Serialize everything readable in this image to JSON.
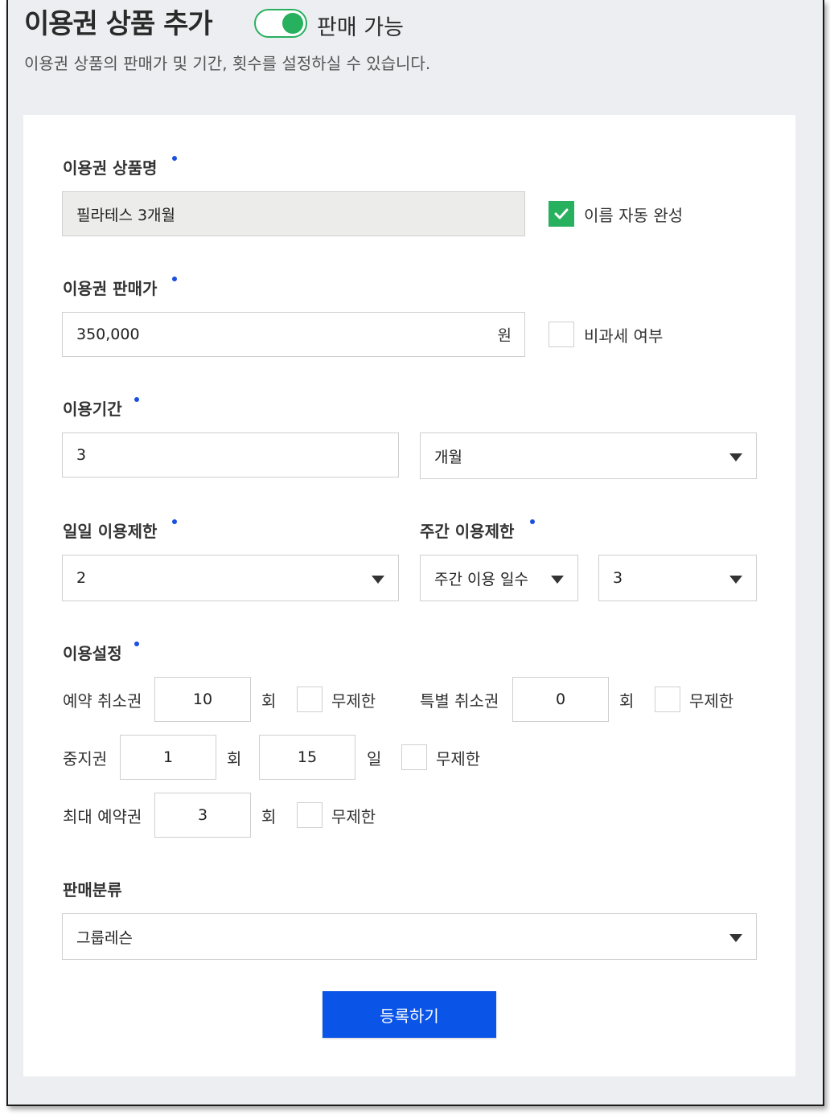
{
  "header": {
    "title": "이용권 상품 추가",
    "toggle_label": "판매 가능",
    "subtitle": "이용권 상품의 판매가 및 기간, 횟수를 설정하실 수 있습니다."
  },
  "form": {
    "product_name": {
      "label": "이용권 상품명",
      "value": "필라테스 3개월",
      "auto_complete_label": "이름 자동 완성"
    },
    "price": {
      "label": "이용권 판매가",
      "value": "350,000",
      "unit": "원",
      "tax_free_label": "비과세 여부"
    },
    "period": {
      "label": "이용기간",
      "value": "3",
      "unit_select": "개월"
    },
    "daily_limit": {
      "label": "일일 이용제한",
      "value": "2"
    },
    "weekly_limit": {
      "label": "주간 이용제한",
      "type_select": "주간 이용 일수",
      "value": "3"
    },
    "usage": {
      "label": "이용설정",
      "reservation_cancel": {
        "label": "예약 취소권",
        "value": "10",
        "unit": "회",
        "unlimited_label": "무제한"
      },
      "special_cancel": {
        "label": "특별 취소권",
        "value": "0",
        "unit": "회",
        "unlimited_label": "무제한"
      },
      "pause": {
        "label": "중지권",
        "count": "1",
        "count_unit": "회",
        "days": "15",
        "days_unit": "일",
        "unlimited_label": "무제한"
      },
      "max_reservation": {
        "label": "최대 예약권",
        "value": "3",
        "unit": "회",
        "unlimited_label": "무제한"
      }
    },
    "category": {
      "label": "판매분류",
      "value": "그룹레슨"
    },
    "submit_label": "등록하기"
  },
  "colors": {
    "accent_green": "#27b05e",
    "primary_blue": "#0a55e8",
    "required_dot": "#1a4fe0"
  }
}
